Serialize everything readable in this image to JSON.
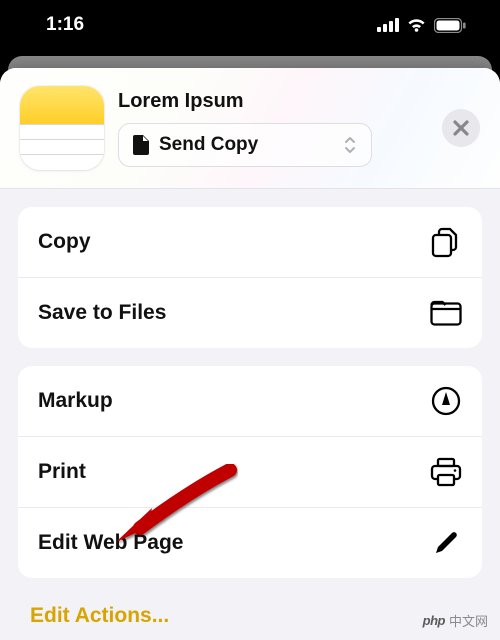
{
  "status": {
    "time": "1:16"
  },
  "header": {
    "title": "Lorem Ipsum",
    "button_label": "Send Copy"
  },
  "groups": [
    {
      "items": [
        {
          "name": "copy",
          "label": "Copy",
          "icon": "copy-icon"
        },
        {
          "name": "save-to-files",
          "label": "Save to Files",
          "icon": "folder-icon"
        }
      ]
    },
    {
      "items": [
        {
          "name": "markup",
          "label": "Markup",
          "icon": "markup-icon"
        },
        {
          "name": "print",
          "label": "Print",
          "icon": "printer-icon"
        },
        {
          "name": "edit-web-page",
          "label": "Edit Web Page",
          "icon": "pencil-icon"
        }
      ]
    }
  ],
  "edit_actions_label": "Edit Actions...",
  "watermark": {
    "brand": "php",
    "text": "中文网"
  }
}
